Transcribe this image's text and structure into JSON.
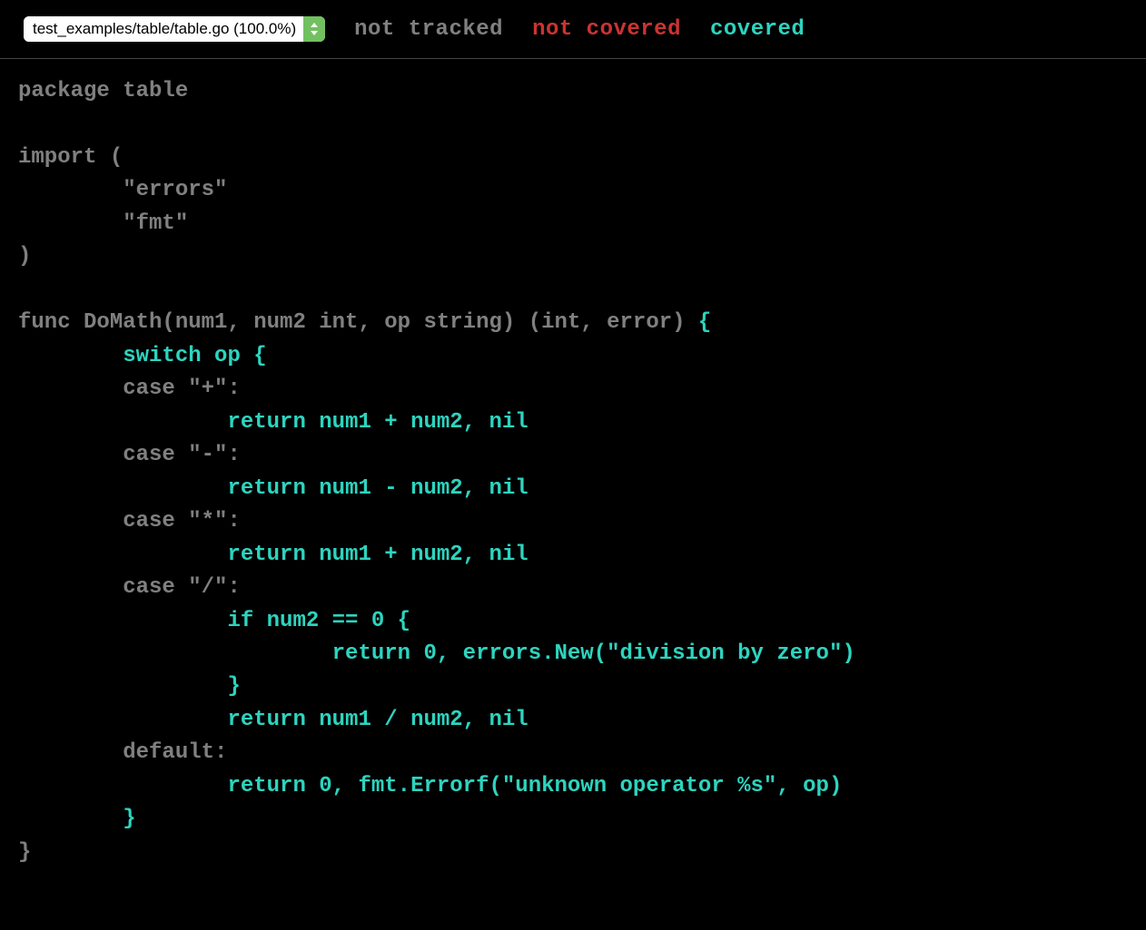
{
  "header": {
    "file_selector": "test_examples/table/table.go (100.0%)",
    "legend": {
      "not_tracked": "not tracked",
      "not_covered": "not covered",
      "covered": "covered"
    }
  },
  "code": {
    "lines": [
      {
        "text": "package table",
        "class": "nottracked"
      },
      {
        "text": "",
        "class": "nottracked"
      },
      {
        "text": "import (",
        "class": "nottracked"
      },
      {
        "text": "        \"errors\"",
        "class": "nottracked"
      },
      {
        "text": "        \"fmt\"",
        "class": "nottracked"
      },
      {
        "text": ")",
        "class": "nottracked"
      },
      {
        "text": "",
        "class": "nottracked"
      },
      {
        "segments": [
          {
            "text": "func DoMath(num1, num2 int, op string) (int, error) ",
            "class": "nottracked"
          },
          {
            "text": "{",
            "class": "covered"
          }
        ]
      },
      {
        "text": "        switch op {",
        "class": "covered"
      },
      {
        "segments": [
          {
            "text": "        ",
            "class": "nottracked"
          },
          {
            "text": "case \"+\":",
            "class": "nottracked"
          }
        ]
      },
      {
        "text": "                return num1 + num2, nil",
        "class": "covered"
      },
      {
        "segments": [
          {
            "text": "        ",
            "class": "nottracked"
          },
          {
            "text": "case \"-\":",
            "class": "nottracked"
          }
        ]
      },
      {
        "text": "                return num1 - num2, nil",
        "class": "covered"
      },
      {
        "segments": [
          {
            "text": "        ",
            "class": "nottracked"
          },
          {
            "text": "case \"*\":",
            "class": "nottracked"
          }
        ]
      },
      {
        "text": "                return num1 + num2, nil",
        "class": "covered"
      },
      {
        "segments": [
          {
            "text": "        ",
            "class": "nottracked"
          },
          {
            "text": "case \"/\":",
            "class": "nottracked"
          }
        ]
      },
      {
        "text": "                if num2 == 0 {",
        "class": "covered"
      },
      {
        "text": "                        return 0, errors.New(\"division by zero\")",
        "class": "covered"
      },
      {
        "text": "                }",
        "class": "covered"
      },
      {
        "text": "                return num1 / num2, nil",
        "class": "covered"
      },
      {
        "segments": [
          {
            "text": "        ",
            "class": "nottracked"
          },
          {
            "text": "default:",
            "class": "nottracked"
          }
        ]
      },
      {
        "text": "                return 0, fmt.Errorf(\"unknown operator %s\", op)",
        "class": "covered"
      },
      {
        "text": "        }",
        "class": "covered"
      },
      {
        "text": "}",
        "class": "nottracked"
      }
    ]
  }
}
